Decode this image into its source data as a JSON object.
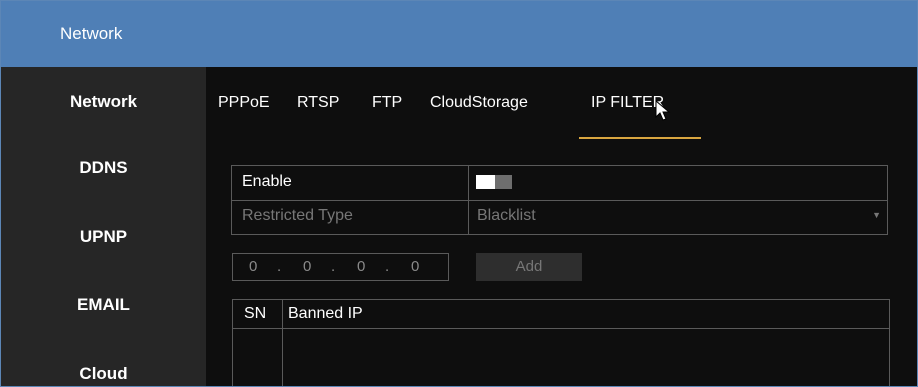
{
  "window": {
    "title": "Network"
  },
  "sidebar": {
    "items": [
      {
        "label": "Network"
      },
      {
        "label": "DDNS"
      },
      {
        "label": "UPNP"
      },
      {
        "label": "EMAIL"
      },
      {
        "label": "Cloud"
      }
    ]
  },
  "tabs": [
    {
      "label": "PPPoE"
    },
    {
      "label": "RTSP"
    },
    {
      "label": "FTP"
    },
    {
      "label": "CloudStorage"
    },
    {
      "label": "IP FILTER",
      "active": true
    }
  ],
  "form": {
    "enable_label": "Enable",
    "enable_state": "off",
    "restricted_type_label": "Restricted Type",
    "restricted_type_value": "Blacklist"
  },
  "ip_input": {
    "octets": [
      "0",
      "0",
      "0",
      "0"
    ],
    "separator": "."
  },
  "add_button": {
    "label": "Add"
  },
  "table": {
    "columns": [
      "SN",
      "Banned IP"
    ],
    "rows": []
  },
  "colors": {
    "titlebar": "#4f7fb6",
    "sidebar": "#262626",
    "background": "#0e0e0e",
    "tab_underline": "#d9a640",
    "border": "#5a5a5a"
  }
}
